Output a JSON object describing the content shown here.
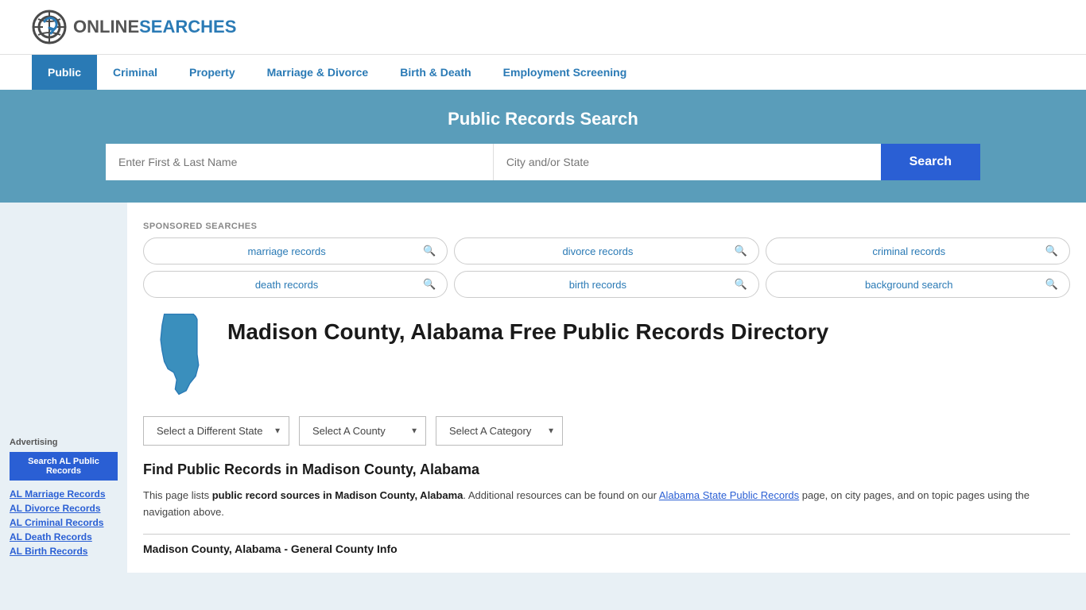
{
  "logo": {
    "online": "ONLINE",
    "searches": "SEARCHES",
    "alt": "OnlineSearches logo"
  },
  "nav": {
    "items": [
      {
        "label": "Public",
        "active": true
      },
      {
        "label": "Criminal",
        "active": false
      },
      {
        "label": "Property",
        "active": false
      },
      {
        "label": "Marriage & Divorce",
        "active": false
      },
      {
        "label": "Birth & Death",
        "active": false
      },
      {
        "label": "Employment Screening",
        "active": false
      }
    ]
  },
  "search_banner": {
    "title": "Public Records Search",
    "name_placeholder": "Enter First & Last Name",
    "location_placeholder": "City and/or State",
    "button_label": "Search"
  },
  "sponsored": {
    "label": "SPONSORED SEARCHES",
    "pills": [
      {
        "text": "marriage records"
      },
      {
        "text": "divorce records"
      },
      {
        "text": "criminal records"
      },
      {
        "text": "death records"
      },
      {
        "text": "birth records"
      },
      {
        "text": "background search"
      }
    ]
  },
  "page": {
    "title": "Madison County, Alabama Free Public Records Directory",
    "state_abbr": "AL"
  },
  "dropdowns": {
    "state": {
      "label": "Select a Different State",
      "options": [
        "Select a Different State"
      ]
    },
    "county": {
      "label": "Select A County",
      "options": [
        "Select A County"
      ]
    },
    "category": {
      "label": "Select A Category",
      "options": [
        "Select A Category"
      ]
    }
  },
  "find_heading": "Find Public Records in Madison County, Alabama",
  "description": {
    "part1": "This page lists ",
    "bold": "public record sources in Madison County, Alabama",
    "part2": ". Additional resources can be found on our ",
    "link_text": "Alabama State Public Records",
    "part3": " page, on city pages, and on topic pages using the navigation above."
  },
  "section_title": "Madison County, Alabama - General County Info",
  "sidebar": {
    "ad_label": "Advertising",
    "ad_button": "Search AL Public Records",
    "links": [
      {
        "text": "AL Marriage Records"
      },
      {
        "text": "AL Divorce Records"
      },
      {
        "text": "AL Criminal Records"
      },
      {
        "text": "AL Death Records"
      },
      {
        "text": "AL Birth Records"
      }
    ]
  }
}
